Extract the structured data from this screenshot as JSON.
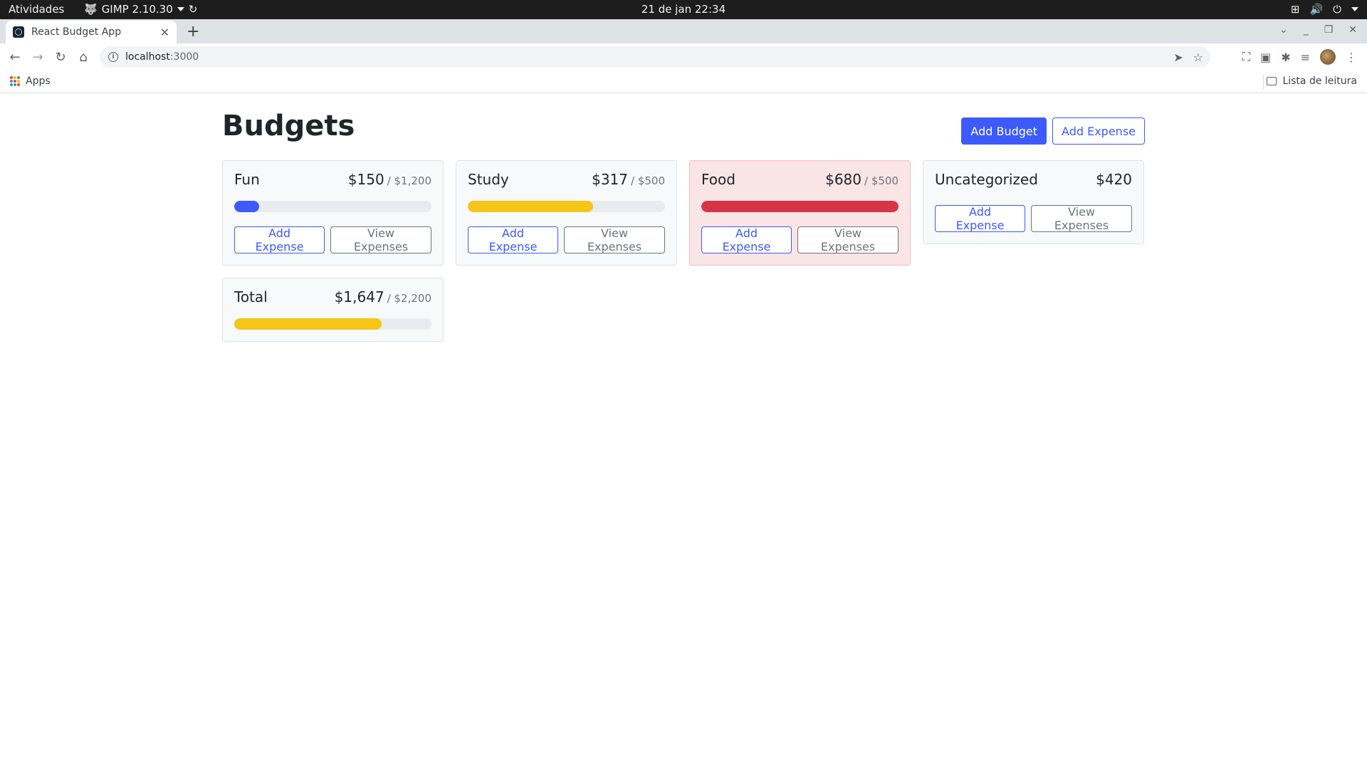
{
  "os_bar": {
    "activities": "Atividades",
    "app_name": "GIMP 2.10.30",
    "clock": "21 de jan  22:34"
  },
  "browser": {
    "tab_title": "React Budget App",
    "url_host": "localhost",
    "url_port": ":3000",
    "bookmarks_apps": "Apps",
    "reading_list": "Lista de leitura"
  },
  "app": {
    "title": "Budgets",
    "add_budget_label": "Add Budget",
    "add_expense_label": "Add Expense",
    "add_expense_card_label": "Add Expense",
    "view_expenses_label": "View Expenses",
    "budgets": [
      {
        "name": "Fun",
        "amount": "$150",
        "max": "/ $1,200",
        "progress": 0.125,
        "bar_color": "#3d5afe"
      },
      {
        "name": "Study",
        "amount": "$317",
        "max": "/ $500",
        "progress": 0.634,
        "bar_color": "#f5c518"
      },
      {
        "name": "Food",
        "amount": "$680",
        "max": "/ $500",
        "progress": 1.0,
        "bar_color": "#d63447"
      }
    ],
    "uncategorized": {
      "name": "Uncategorized",
      "amount": "$420"
    },
    "total": {
      "name": "Total",
      "amount": "$1,647",
      "max": "/ $2,200",
      "progress": 0.749,
      "bar_color": "#f5c518"
    }
  },
  "colors": {
    "primary": "#3d5afe",
    "warning": "#f5c518",
    "danger": "#d63447",
    "danger_bg": "#f9e4e6"
  }
}
